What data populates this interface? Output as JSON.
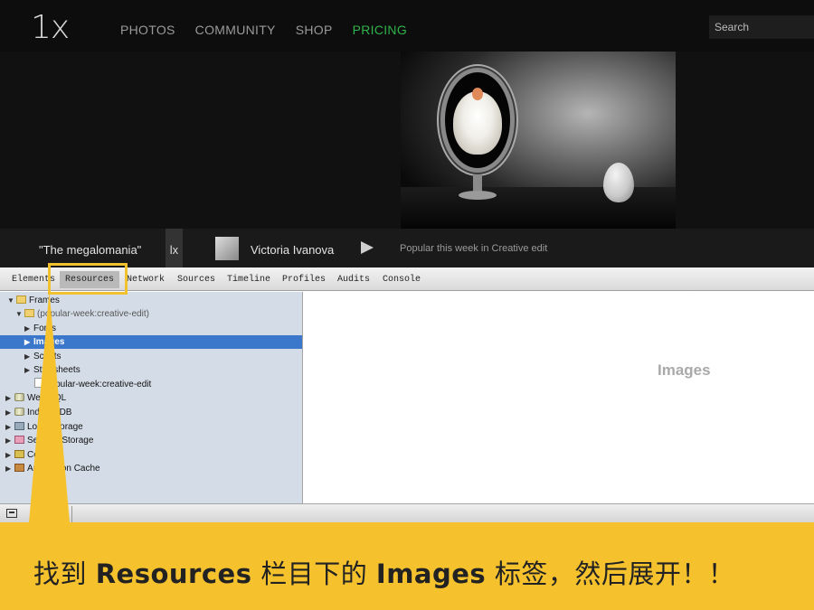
{
  "site": {
    "logo": "1x",
    "nav": [
      {
        "label": "PHOTOS"
      },
      {
        "label": "COMMUNITY"
      },
      {
        "label": "SHOP"
      },
      {
        "label": "PRICING"
      }
    ],
    "active_nav": "PRICING",
    "active_color": "#2fb34a",
    "search_placeholder": "Search"
  },
  "caption": {
    "title": "\"The megalomania\"",
    "mark": "lx",
    "author": "Victoria Ivanova",
    "gallery": "Popular this week in Creative edit"
  },
  "devtools": {
    "tabs": [
      "Elements",
      "Resources",
      "Network",
      "Sources",
      "Timeline",
      "Profiles",
      "Audits",
      "Console"
    ],
    "selected_tab": "Resources",
    "tree": [
      {
        "label": "Frames",
        "icon": "folder-icon",
        "arrow": "▼"
      },
      {
        "label": "(popular-week:creative-edit)",
        "icon": "folder-icon",
        "arrow": "▼"
      },
      {
        "label": "Fonts",
        "icon": "",
        "arrow": "▶"
      },
      {
        "label": "Images",
        "icon": "",
        "arrow": "▶",
        "selected": true
      },
      {
        "label": "Scripts",
        "icon": "",
        "arrow": "▶"
      },
      {
        "label": "Stylesheets",
        "icon": "",
        "arrow": "▶"
      },
      {
        "label": "popular-week:creative-edit",
        "icon": "document-icon",
        "arrow": ""
      },
      {
        "label": "Web SQL",
        "icon": "database-icon",
        "arrow": "▶"
      },
      {
        "label": "IndexedDB",
        "icon": "database-icon",
        "arrow": "▶"
      },
      {
        "label": "Local Storage",
        "icon": "storage-grid-icon",
        "arrow": "▶"
      },
      {
        "label": "Session Storage",
        "icon": "session-storage-icon",
        "arrow": "▶"
      },
      {
        "label": "Cookies",
        "icon": "cookie-icon",
        "arrow": "▶"
      },
      {
        "label": "Application Cache",
        "icon": "app-cache-icon",
        "arrow": "▶"
      }
    ],
    "viewer_label": "Images",
    "selected_color": "#3b78cb"
  },
  "annotation": {
    "pre": "找到 ",
    "bold1": "Resources",
    "mid": " 栏目下的 ",
    "bold2": "Images",
    "post": " 标签，然后展开！！",
    "color": "#f5c22e"
  }
}
